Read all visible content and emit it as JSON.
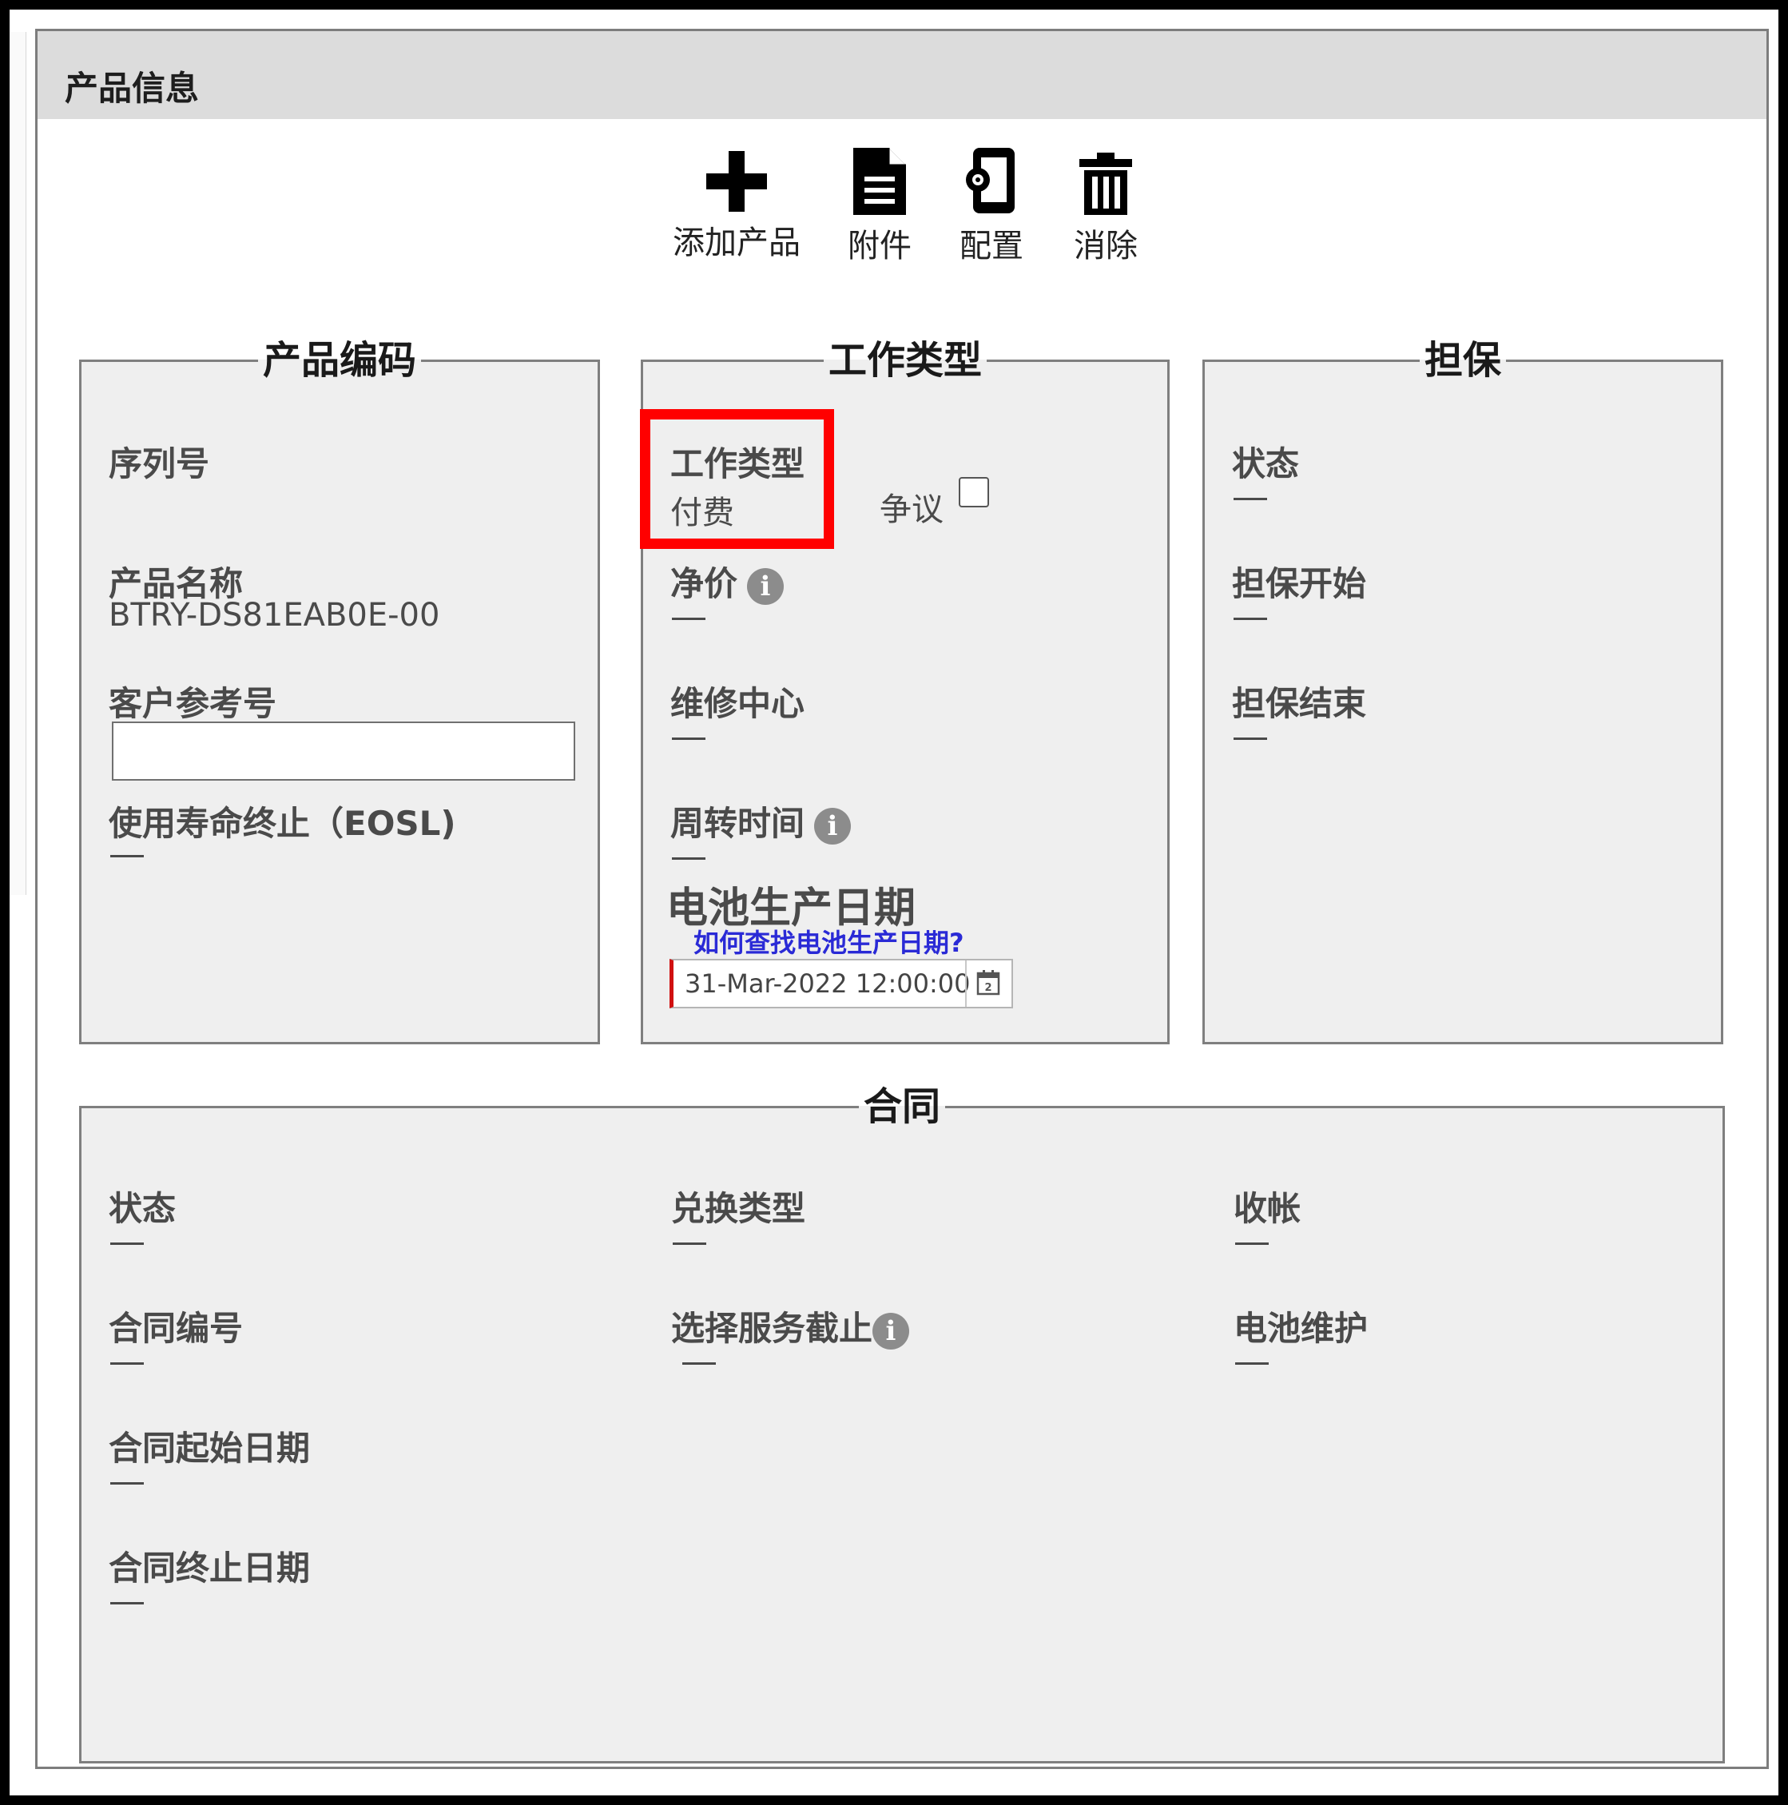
{
  "panel": {
    "title": "产品信息"
  },
  "toolbar": {
    "add": {
      "label": "添加产品",
      "icon": "plus-icon"
    },
    "attach": {
      "label": "附件",
      "icon": "document-icon"
    },
    "config": {
      "label": "配置",
      "icon": "device-config-icon"
    },
    "delete": {
      "label": "消除",
      "icon": "trash-icon"
    }
  },
  "product_code": {
    "legend": "产品编码",
    "serial_label": "序列号",
    "name_label": "产品名称",
    "name_value": "BTRY-DS81EAB0E-00",
    "ref_label": "客户参考号",
    "ref_value": "",
    "eosl_label": "使用寿命终止（EOSL)"
  },
  "work_type": {
    "legend": "工作类型",
    "type_label": "工作类型",
    "type_value": "付费",
    "dispute_label": "争议",
    "dispute_checked": false,
    "net_price_label": "净价",
    "repair_center_label": "维修中心",
    "turnaround_label": "周转时间",
    "battery_title": "电池生产日期",
    "battery_link": "如何查找电池生产日期?",
    "battery_date": "31-Mar-2022 12:00:00"
  },
  "warranty": {
    "legend": "担保",
    "status_label": "状态",
    "start_label": "担保开始",
    "end_label": "担保结束"
  },
  "contract": {
    "legend": "合同",
    "status_label": "状态",
    "number_label": "合同编号",
    "start_label": "合同起始日期",
    "end_label": "合同终止日期",
    "exchange_label": "兑换类型",
    "service_cutoff_label": "选择服务截止",
    "billing_label": "收帐",
    "battery_maint_label": "电池维护"
  },
  "colors": {
    "highlight": "#ff0000",
    "link": "#2a2ad6",
    "group_bg": "#efefef",
    "header_bg": "#dcdcdc"
  }
}
